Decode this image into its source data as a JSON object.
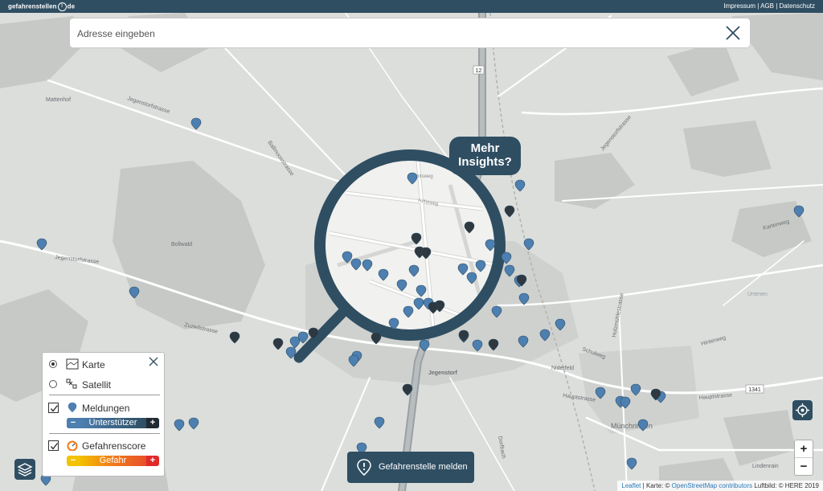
{
  "header": {
    "brand_left": "gefahrenstellen",
    "brand_mark": "!",
    "brand_right": "de",
    "links": [
      "Impressum",
      "AGB",
      "Datenschutz"
    ],
    "sep": "|"
  },
  "search": {
    "placeholder": "Adresse eingeben"
  },
  "map_labels": {
    "mattenhof": "Mattenhof",
    "bollwald": "Bollwald",
    "jegenstorf": "Jegenstorf",
    "niderfeld": "Niderfeld",
    "munchringen": "Münchringen",
    "lindenrain": "Lindenrain",
    "road_12": "12",
    "road_1341": "1341",
    "hauptstrasse": "Hauptstrasse",
    "hauptstrasse2": "Hauptstrasse",
    "jegenstorfstrasse": "Jegenstorfstrasse",
    "jegenstorfstrasse2": "Jegenstorfstrasse",
    "zuzwilstrasse": "Zuzwilstrasse",
    "ballmoos": "Ballmoosstrasse",
    "kernenriedstr": "Jegenstorfstrasse",
    "holzmuhle": "Holzmühlestrasse",
    "kartenweg": "Kartenweg",
    "urtenen": "Urtenen",
    "schulweg": "Schulweg",
    "hinterweg": "Hinterweg",
    "dorfbach": "Dorfbach",
    "answeg": "Amtsweg",
    "hoheweg": "Höheweg"
  },
  "insights": {
    "line1": "Mehr",
    "line2": "Insights?"
  },
  "layer_panel": {
    "karte": "Karte",
    "satellit": "Satellit",
    "meldungen": "Meldungen",
    "unterstuetzer": "Unterstützer",
    "gefahrenscore": "Gefahrenscore",
    "gefahr": "Gefahr",
    "minus": "−",
    "plus": "+"
  },
  "report_button": {
    "label": "Gefahrenstelle melden"
  },
  "zoom": {
    "in": "+",
    "out": "−"
  },
  "attribution": {
    "leaflet": "Leaflet",
    "sep": "|",
    "karte": "Karte: ©",
    "osm": "OpenStreetMap contributors",
    "luftbild": "Luftbild: © HERE 2019"
  },
  "colors": {
    "brand": "#2f4e62",
    "pin_blue": "#4d7fb0",
    "pin_dark": "#2d3840",
    "gefahr_yellow": "#f3c200",
    "gefahr_orange": "#f07a1a",
    "gefahr_red": "#e02a2a"
  }
}
